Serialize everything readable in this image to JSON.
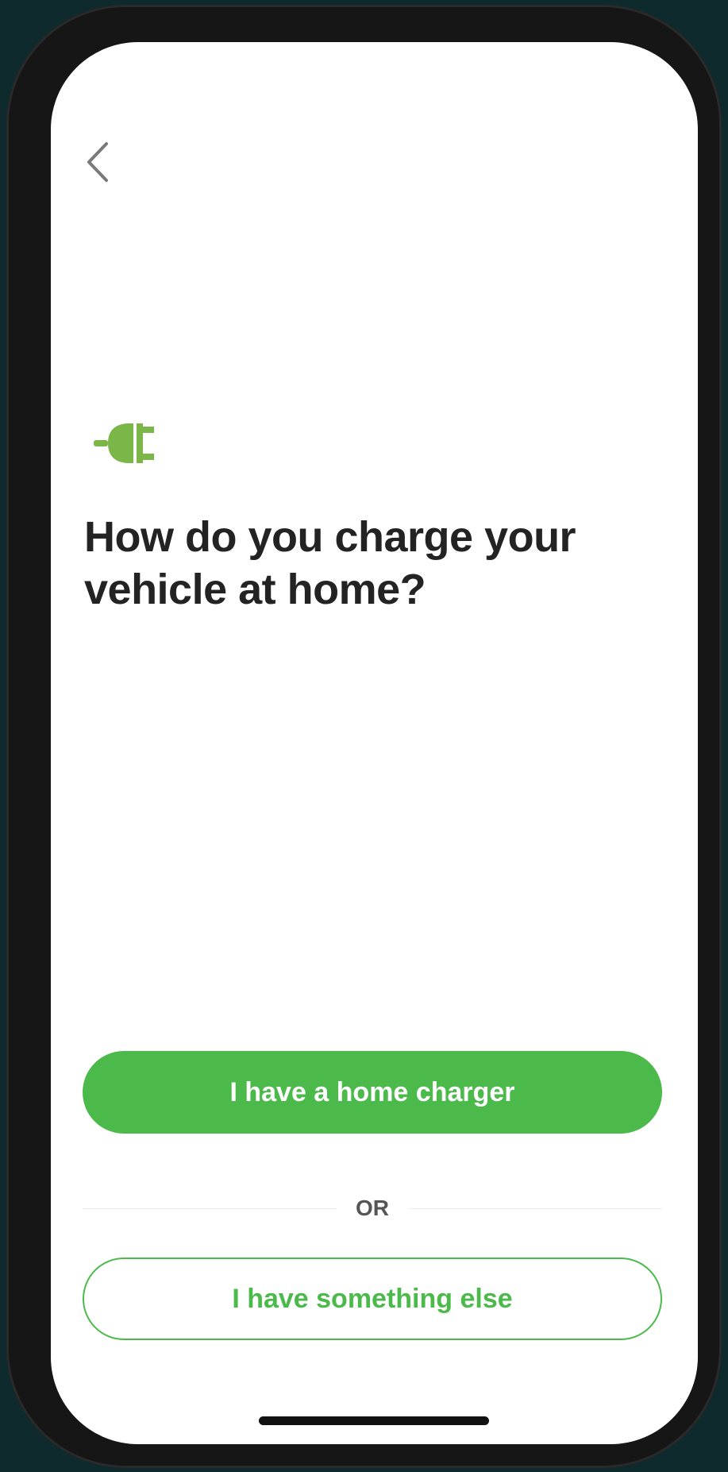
{
  "screen": {
    "title": "How do you charge your vehicle at home?",
    "back_icon": "chevron-left-icon",
    "header_icon": "plug-icon"
  },
  "actions": {
    "primary_label": "I have a home charger",
    "divider_label": "OR",
    "secondary_label": "I have something else"
  },
  "colors": {
    "accent": "#4cba4a",
    "background": "#ffffff",
    "text": "#232323",
    "frame": "#0f2a2c"
  }
}
